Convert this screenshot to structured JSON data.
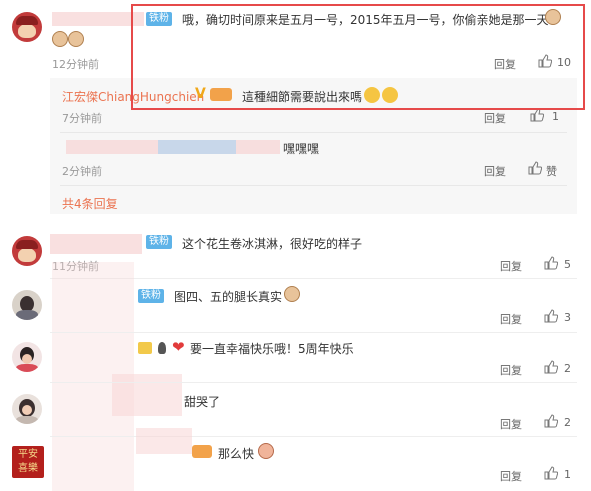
{
  "badge_label": "铁粉",
  "comment1": {
    "text": "哦，确切时间原来是五月一号，2015年五月一号，你偷亲她是那一天",
    "time": "12分钟前",
    "reply_label": "回复",
    "likes": "10"
  },
  "reply1": {
    "author": "江宏傑ChiangHungchieh",
    "text": "這種細節需要說出來嗎",
    "time": "7分钟前",
    "reply_label": "回复",
    "likes": "1"
  },
  "reply2": {
    "text": "嘿嘿嘿",
    "time": "2分钟前",
    "reply_label": "回复",
    "likes": "赞"
  },
  "more_replies": "共4条回复",
  "comment2": {
    "text": "这个花生卷冰淇淋，很好吃的样子",
    "time": "11分钟前",
    "reply_label": "回复",
    "likes": "5"
  },
  "comment3": {
    "text": "图四、五的腿长真实",
    "reply_label": "回复",
    "likes": "3"
  },
  "comment4": {
    "text": "要一直幸福快乐哦！5周年快乐",
    "reply_label": "回复",
    "likes": "2"
  },
  "comment5": {
    "text": "甜哭了",
    "reply_label": "回复",
    "likes": "2"
  },
  "comment6": {
    "text": "那么快",
    "reply_label": "回复",
    "likes": "1"
  },
  "avatar6_text": "平安喜樂",
  "colors": {
    "badge": "#5eb3e8",
    "highlight": "#e64a4a",
    "link": "#eb7350",
    "gold": "#f0a81a"
  }
}
